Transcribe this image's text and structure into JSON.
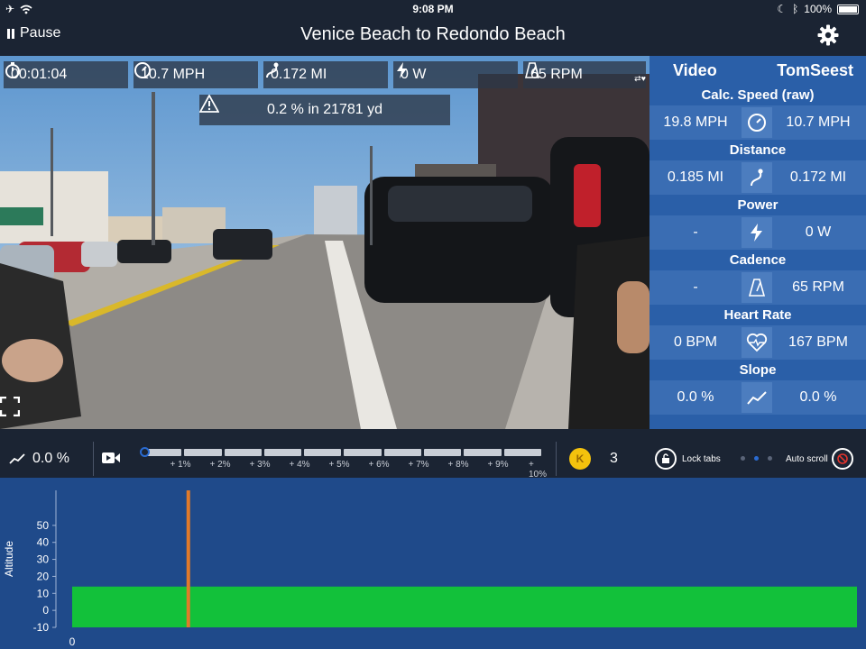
{
  "status_bar": {
    "time": "9:08 PM",
    "battery": "100%"
  },
  "nav": {
    "pause_label": "Pause",
    "title": "Venice Beach to Redondo Beach"
  },
  "overlay": {
    "elapsed": "00:01:04",
    "speed": "10.7 MPH",
    "distance": "0.172 MI",
    "power": "0 W",
    "cadence": "65 RPM",
    "slope_ahead": "0.2 % in 21781 yd"
  },
  "panel": {
    "col_video": "Video",
    "col_user": "TomSeest",
    "metrics": [
      {
        "label": "Calc. Speed (raw)",
        "video": "19.8 MPH",
        "user": "10.7 MPH",
        "icon": "speedometer-icon"
      },
      {
        "label": "Distance",
        "video": "0.185 MI",
        "user": "0.172 MI",
        "icon": "route-icon"
      },
      {
        "label": "Power",
        "video": "-",
        "user": "0 W",
        "icon": "lightning-icon"
      },
      {
        "label": "Cadence",
        "video": "-",
        "user": "65 RPM",
        "icon": "metronome-icon"
      },
      {
        "label": "Heart Rate",
        "video": "0 BPM",
        "user": "167 BPM",
        "icon": "heart-icon"
      },
      {
        "label": "Slope",
        "video": "0.0 %",
        "user": "0.0 %",
        "icon": "slope-icon"
      }
    ]
  },
  "strip": {
    "slope": "0.0 %",
    "slope_ticks": [
      "+ 1%",
      "+ 2%",
      "+ 3%",
      "+ 4%",
      "+ 5%",
      "+ 6%",
      "+ 7%",
      "+ 8%",
      "+ 9%",
      "+ 10%"
    ],
    "coin_letter": "K",
    "coin_count": "3",
    "lock_label": "Lock tabs",
    "autoscroll_label": "Auto scroll"
  },
  "colors": {
    "accent": "#2a5fa8",
    "chart_bg": "#1f4a8a",
    "altitude_fill": "#12c13a",
    "marker": "#e07a2a",
    "coin": "#f4c20d"
  },
  "chart_data": {
    "type": "area",
    "ylabel": "Altitude",
    "xlabel": "",
    "ylim": [
      -10,
      60
    ],
    "yticks": [
      "50",
      "40",
      "30",
      "20",
      "10",
      "0",
      "-10"
    ],
    "xticks": [
      "0"
    ],
    "x": [
      0,
      1
    ],
    "values": [
      14,
      14
    ],
    "marker_x": 0.148
  }
}
